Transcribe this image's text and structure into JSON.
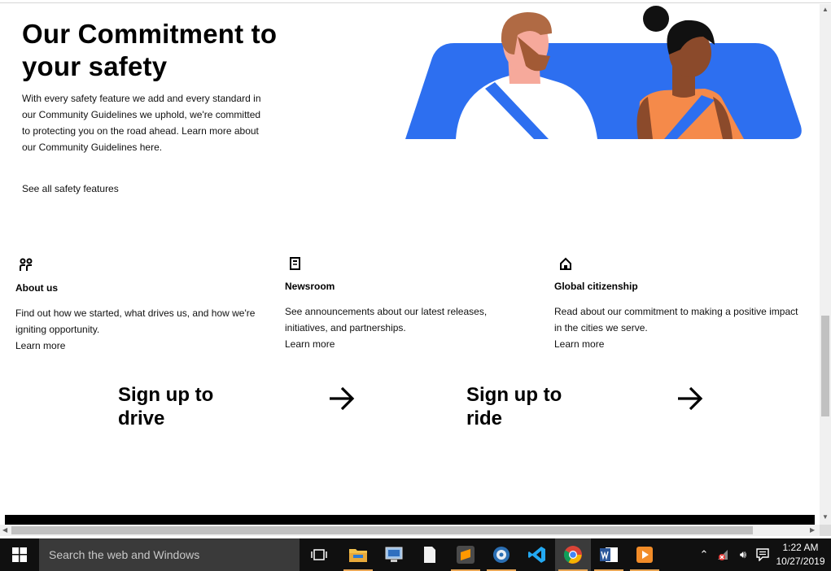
{
  "hero": {
    "title": "Our Commitment to your safety",
    "paragraph": "With every safety feature we add and every standard in our Community Guidelines we uphold, we're committed to protecting you on the road ahead. Learn more about our Community Guidelines here.",
    "link": "See all safety features"
  },
  "cards": [
    {
      "icon": "people-icon",
      "title": "About us",
      "desc": "Find out how we started, what drives us, and how we're igniting opportunity.",
      "link": "Learn more"
    },
    {
      "icon": "newspaper-icon",
      "title": "Newsroom",
      "desc": "See announcements about our latest releases, initiatives, and partnerships.",
      "link": "Learn more"
    },
    {
      "icon": "home-icon",
      "title": "Global citizenship",
      "desc": "Read about our commitment to making a positive impact in the cities we serve.",
      "link": "Learn more"
    }
  ],
  "signup": {
    "drive": "Sign up to drive",
    "ride": "Sign up to ride"
  },
  "colors": {
    "car_blue": "#2d6ff0",
    "orange_shirt": "#f58a4a"
  },
  "taskbar": {
    "search_placeholder": "Search the web and Windows",
    "time": "1:22 AM",
    "date": "10/27/2019"
  }
}
